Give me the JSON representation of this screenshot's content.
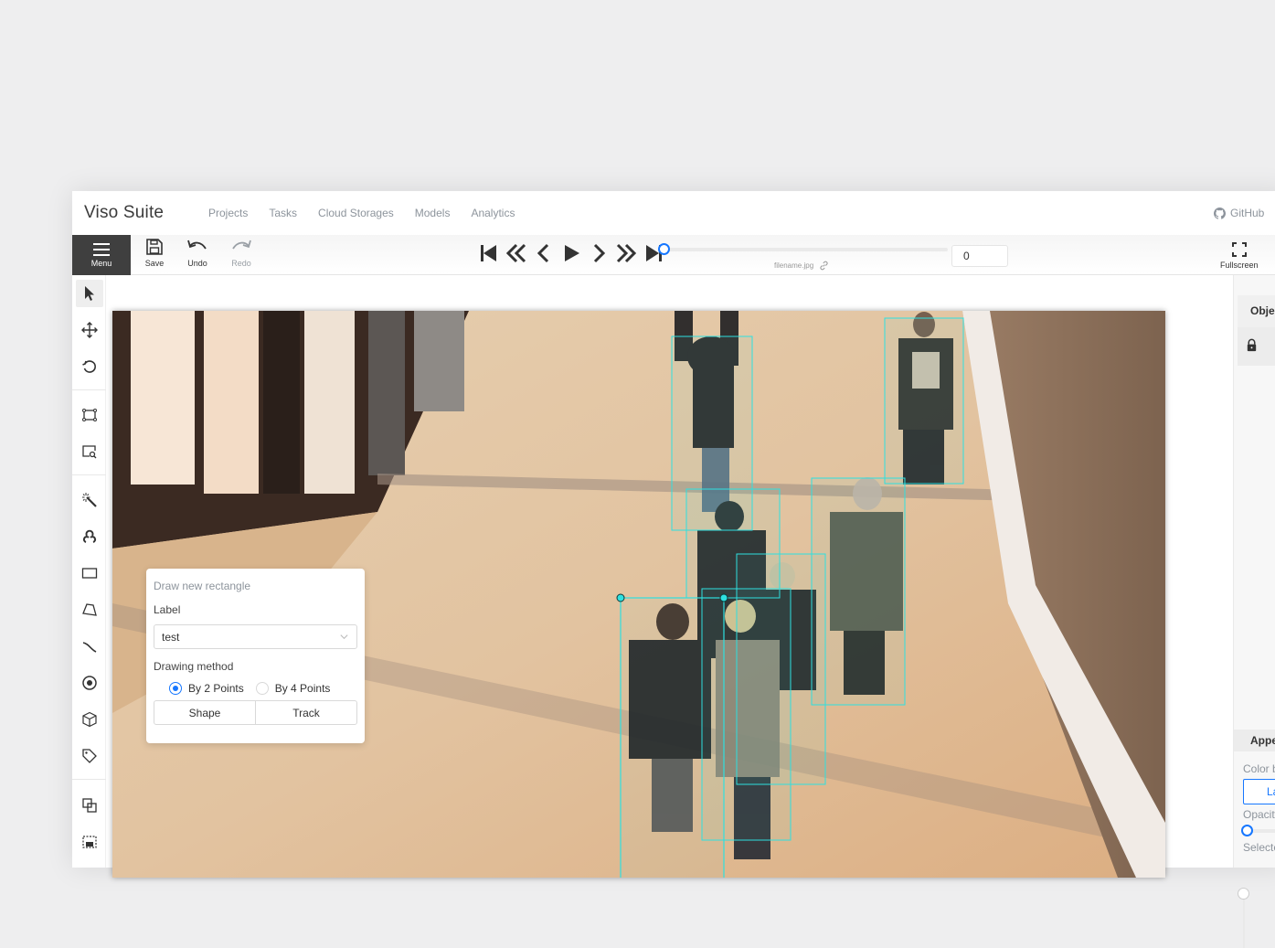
{
  "header": {
    "brand": "Viso Suite",
    "nav": [
      "Projects",
      "Tasks",
      "Cloud Storages",
      "Models",
      "Analytics"
    ],
    "github_label": "GitHub"
  },
  "toolbar": {
    "menu_label": "Menu",
    "save_label": "Save",
    "undo_label": "Undo",
    "redo_label": "Redo",
    "player_controls": [
      "first-frame-icon",
      "back-step-icon",
      "previous-frame-icon",
      "play-icon",
      "next-frame-icon",
      "forward-step-icon",
      "last-frame-icon"
    ],
    "frame_progress": 0,
    "filename": "filename.jpg",
    "frame_number": "0",
    "fullscreen_label": "Fullscreen"
  },
  "sidebar": {
    "tools": [
      {
        "name": "cursor-icon",
        "active": true
      },
      {
        "name": "move-icon"
      },
      {
        "name": "rotate-icon"
      },
      {
        "name": "fit-image-icon"
      },
      {
        "name": "zoom-region-icon"
      },
      {
        "name": "magic-wand-icon"
      },
      {
        "name": "openvino-tools-icon"
      },
      {
        "name": "rectangle-icon"
      },
      {
        "name": "polygon-icon"
      },
      {
        "name": "polyline-icon"
      },
      {
        "name": "points-icon"
      },
      {
        "name": "cuboid-icon"
      },
      {
        "name": "tag-icon"
      },
      {
        "name": "merge-icon"
      },
      {
        "name": "group-icon"
      }
    ]
  },
  "draw_popover": {
    "title": "Draw new rectangle",
    "label_caption": "Label",
    "label_value": "test",
    "method_caption": "Drawing method",
    "methods": [
      {
        "label": "By 2 Points",
        "selected": true
      },
      {
        "label": "By 4 Points",
        "selected": false
      }
    ],
    "shape_button": "Shape",
    "track_button": "Track"
  },
  "annotations": {
    "color": "#2ee0e0",
    "boxes_count": 7
  },
  "right_panel": {
    "tab_label": "Objects",
    "appearance_label": "Appearance",
    "color_by_label": "Color by",
    "label_button": "Label",
    "opacity_label": "Opacity",
    "selected_opacity_label": "Selected opacity"
  }
}
